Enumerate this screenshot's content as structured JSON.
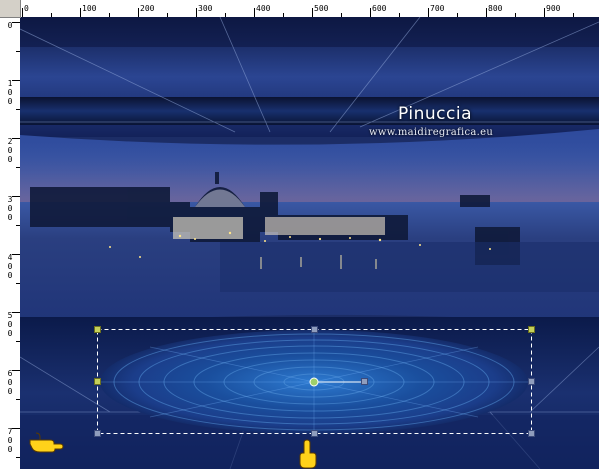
{
  "ruler": {
    "horizontal_labels": [
      "0",
      "100",
      "200",
      "300",
      "400",
      "500",
      "600",
      "700",
      "800",
      "900"
    ],
    "vertical_labels": [
      "0",
      "100",
      "200",
      "300",
      "400",
      "500",
      "600",
      "700"
    ]
  },
  "watermark": {
    "title": "Pinuccia",
    "url": "www.maidiregrafica.eu"
  },
  "colors": {
    "background": "#1c2d66",
    "handle": "#8f9dbd",
    "corner_handle": "#c5d05a",
    "ruler": "#ffffff"
  },
  "icons": {
    "pointer_left": "pointing-hand-icon",
    "pointer_bottom": "pointing-hand-icon"
  }
}
